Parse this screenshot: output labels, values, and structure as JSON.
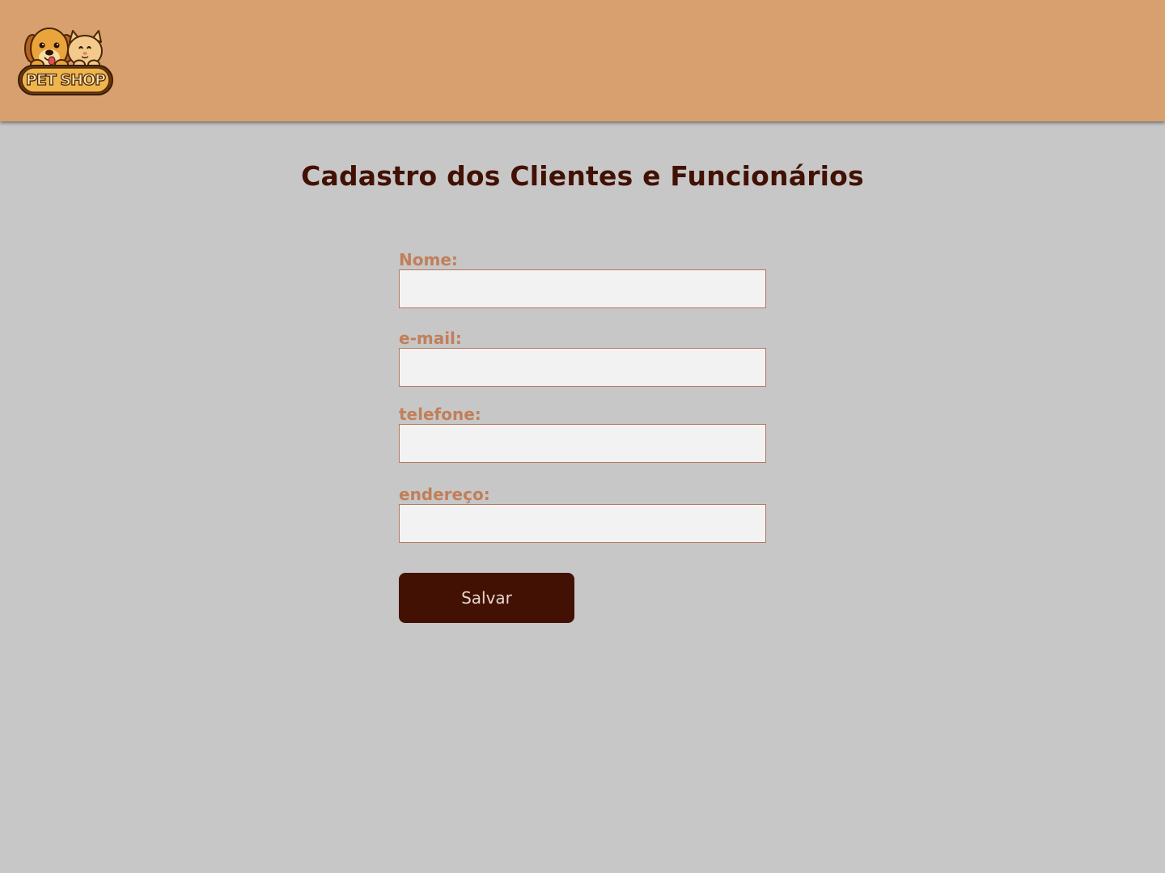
{
  "header": {
    "logo_text": "PET SHOP",
    "logo_icon": "dog-and-cat-logo-icon",
    "background_color": "#d9a06f"
  },
  "main": {
    "title": "Cadastro dos Clientes e Funcionários",
    "form": {
      "fields": [
        {
          "label": "Nome:",
          "value": ""
        },
        {
          "label": "e-mail:",
          "value": ""
        },
        {
          "label": "telefone:",
          "value": ""
        },
        {
          "label": "endereço:",
          "value": ""
        }
      ],
      "submit_label": "Salvar"
    }
  },
  "colors": {
    "page_background": "#c7c7c7",
    "title": "#421104",
    "label": "#c17f5a",
    "input_border": "#b7775a",
    "button_background": "#421104",
    "button_text": "#e3d6cc"
  }
}
